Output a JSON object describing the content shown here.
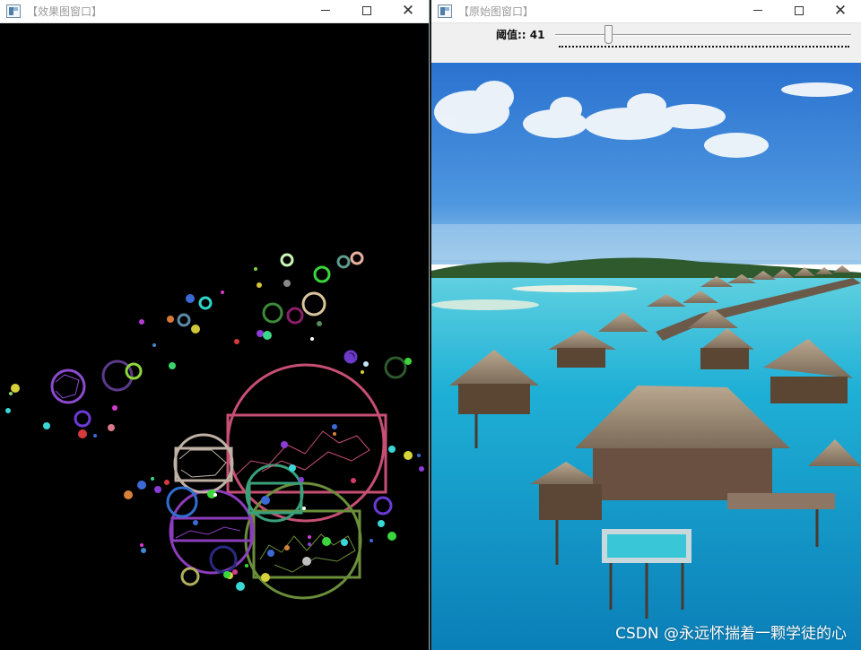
{
  "left_window": {
    "title": "【效果图窗口】",
    "controls": {
      "minimize": "",
      "maximize": "",
      "close": "✕"
    }
  },
  "right_window": {
    "title": "【原始图窗口】",
    "controls": {
      "minimize": "",
      "maximize": "",
      "close": "✕"
    },
    "trackbar": {
      "label": "阈值:: 41",
      "value": 41
    }
  },
  "watermark": "CSDN @永远怀揣着一颗学徒的心",
  "colors": {
    "canvas_background": "#000000",
    "sky": "#2f7fd6",
    "water": "#1ea6cf"
  }
}
